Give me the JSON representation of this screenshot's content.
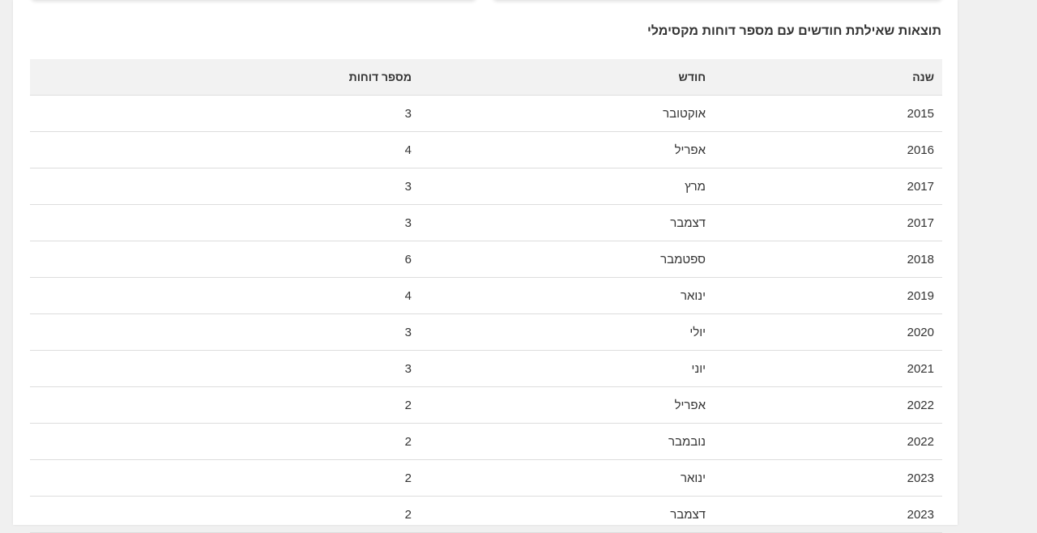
{
  "page": {
    "title": "תוצאות שאילתת חודשים עם מספר דוחות מקסימלי"
  },
  "table": {
    "headers": {
      "year": "שנה",
      "month": "חודש",
      "reports": "מספר דוחות"
    },
    "rows": [
      {
        "year": "2015",
        "month": "אוקטובר",
        "reports": "3"
      },
      {
        "year": "2016",
        "month": "אפריל",
        "reports": "4"
      },
      {
        "year": "2017",
        "month": "מרץ",
        "reports": "3"
      },
      {
        "year": "2017",
        "month": "דצמבר",
        "reports": "3"
      },
      {
        "year": "2018",
        "month": "ספטמבר",
        "reports": "6"
      },
      {
        "year": "2019",
        "month": "ינואר",
        "reports": "4"
      },
      {
        "year": "2020",
        "month": "יולי",
        "reports": "3"
      },
      {
        "year": "2021",
        "month": "יוני",
        "reports": "3"
      },
      {
        "year": "2022",
        "month": "אפריל",
        "reports": "2"
      },
      {
        "year": "2022",
        "month": "נובמבר",
        "reports": "2"
      },
      {
        "year": "2023",
        "month": "ינואר",
        "reports": "2"
      },
      {
        "year": "2023",
        "month": "דצמבר",
        "reports": "2"
      }
    ]
  }
}
